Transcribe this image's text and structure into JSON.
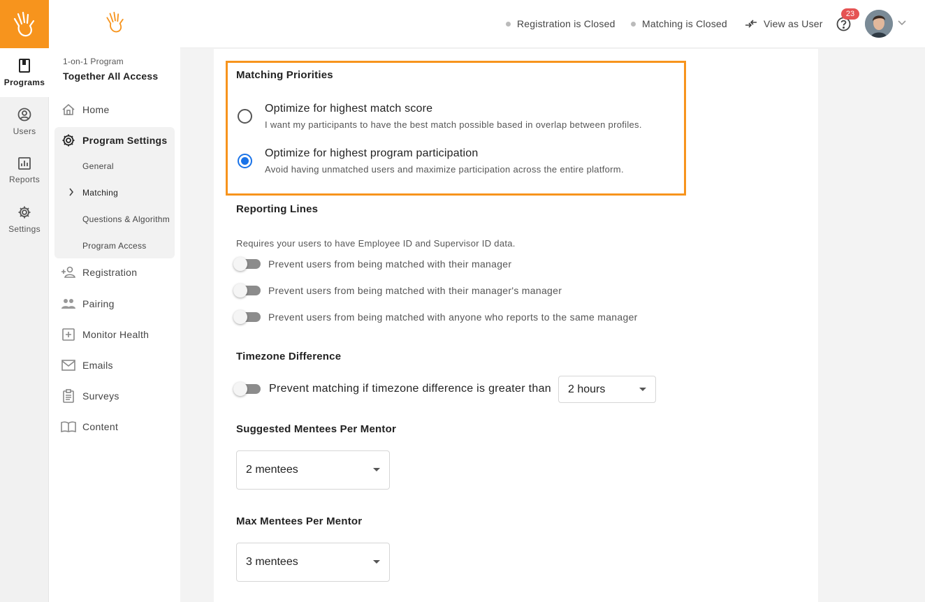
{
  "rail": {
    "items": [
      {
        "label": "Programs",
        "icon": "book-icon"
      },
      {
        "label": "Users",
        "icon": "user-circle-icon"
      },
      {
        "label": "Reports",
        "icon": "bar-chart-icon"
      },
      {
        "label": "Settings",
        "icon": "gear-icon"
      }
    ]
  },
  "sidebar": {
    "program_type": "1-on-1 Program",
    "program_name": "Together All Access",
    "home": "Home",
    "program_settings": "Program Settings",
    "sub_items": [
      "General",
      "Matching",
      "Questions & Algorithm",
      "Program Access"
    ],
    "items": [
      "Registration",
      "Pairing",
      "Monitor Health",
      "Emails",
      "Surveys",
      "Content"
    ]
  },
  "header": {
    "registration_status": "Registration is Closed",
    "matching_status": "Matching is Closed",
    "view_as_user": "View as User",
    "notification_count": "23"
  },
  "matching_priorities": {
    "title": "Matching Priorities",
    "options": [
      {
        "title": "Optimize for highest match score",
        "desc": "I want my participants to have the best match possible based in overlap between profiles.",
        "selected": false
      },
      {
        "title": "Optimize for highest program participation",
        "desc": "Avoid having unmatched users and maximize participation across the entire platform.",
        "selected": true
      }
    ]
  },
  "reporting_lines": {
    "title": "Reporting Lines",
    "note": "Requires your users to have Employee ID and Supervisor ID data.",
    "toggles": [
      "Prevent users from being matched with their manager",
      "Prevent users from being matched with their manager's manager",
      "Prevent users from being matched with anyone who reports to the same manager"
    ]
  },
  "timezone": {
    "title": "Timezone Difference",
    "label": "Prevent matching if timezone difference is greater than",
    "value": "2 hours"
  },
  "suggested": {
    "title": "Suggested Mentees Per Mentor",
    "value": "2 mentees"
  },
  "max": {
    "title": "Max Mentees Per Mentor",
    "value": "3 mentees"
  },
  "colors": {
    "accent": "#f7941d",
    "radio": "#1a73e8",
    "badge": "#e55353"
  }
}
